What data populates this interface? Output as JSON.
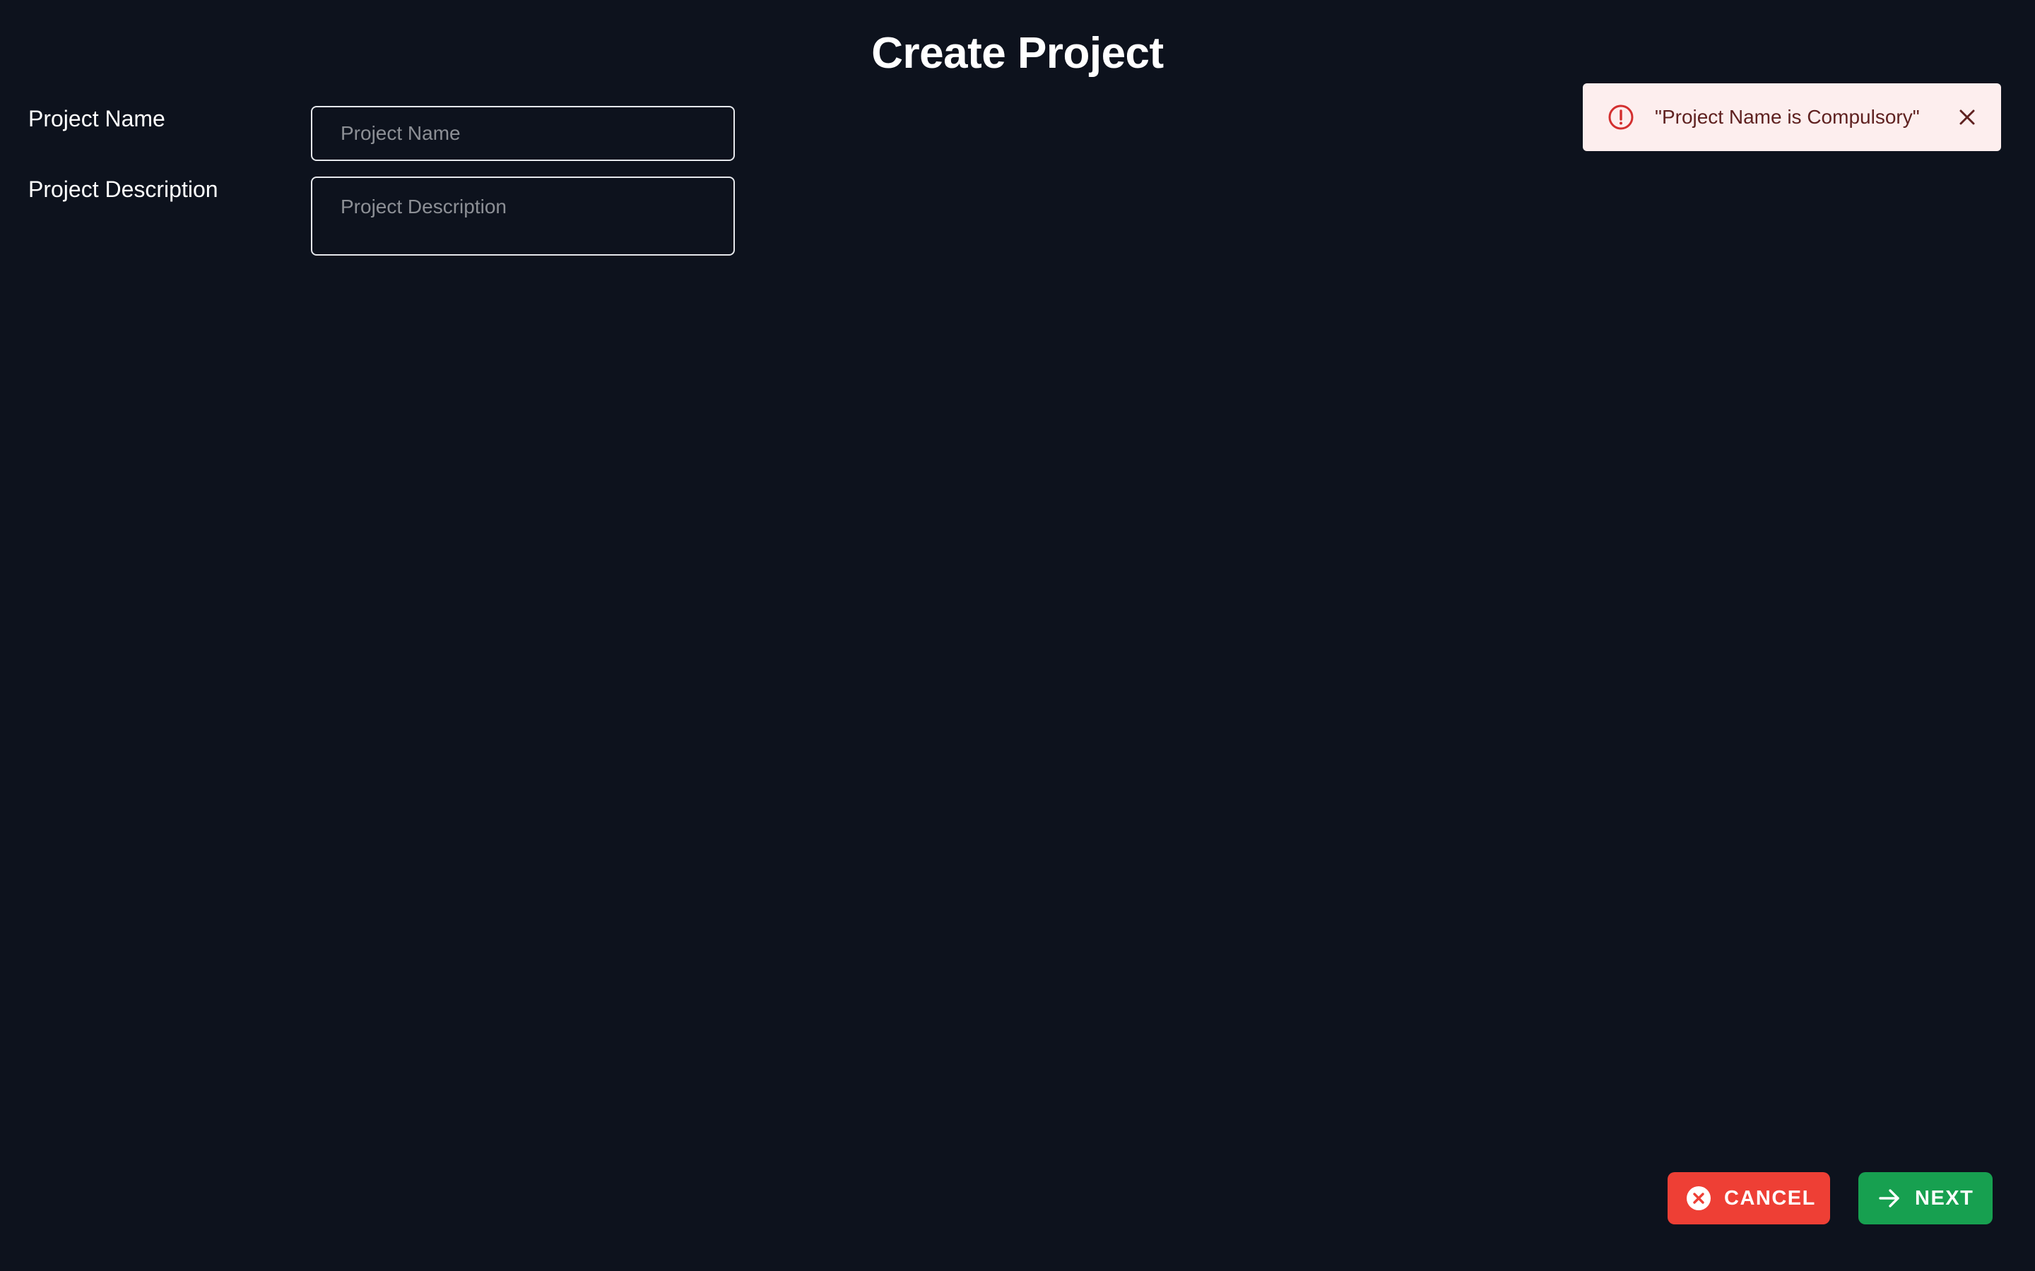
{
  "header": {
    "title": "Create Project"
  },
  "form": {
    "project_name": {
      "label": "Project Name",
      "placeholder": "Project Name",
      "value": ""
    },
    "project_description": {
      "label": "Project Description",
      "placeholder": "Project Description",
      "value": ""
    }
  },
  "toast": {
    "type": "error",
    "icon": "error-outline-icon",
    "message": "\"Project Name is Compulsory\"",
    "close_icon": "close-icon"
  },
  "actions": {
    "cancel": {
      "label": "CANCEL",
      "icon": "cancel-circle-icon",
      "color": "#ee3f35"
    },
    "next": {
      "label": "NEXT",
      "icon": "arrow-right-icon",
      "color": "#17a050"
    }
  },
  "theme": {
    "background": "#0d121d",
    "toast_background": "#fdeeee",
    "toast_text": "#5f2120",
    "error_accent": "#d32f2f"
  }
}
